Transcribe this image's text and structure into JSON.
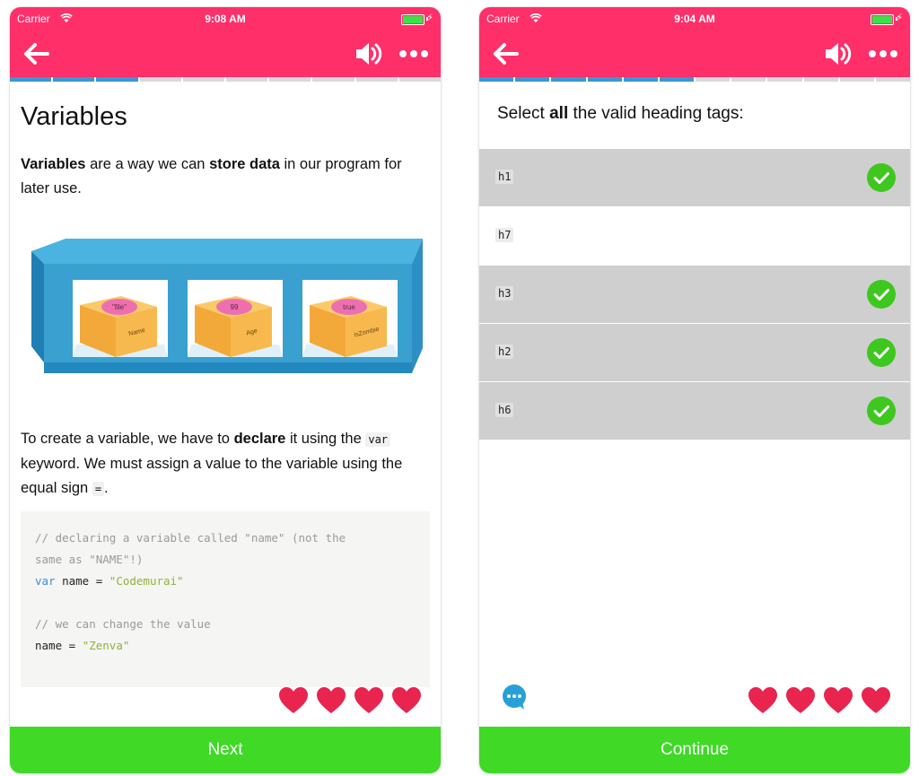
{
  "colors": {
    "header": "#ff2f6a",
    "progress_done": "#3b97d3",
    "button": "#3fd926",
    "heart": "#e8244f",
    "check": "#3ec71f"
  },
  "left": {
    "status": {
      "carrier": "Carrier",
      "time": "9:08 AM",
      "battery": 0.9
    },
    "progress": {
      "total": 10,
      "done": 3
    },
    "title": "Variables",
    "intro": {
      "bold1": "Variables",
      "t1": " are a way we can ",
      "bold2": "store data",
      "t2": " in our program for later use."
    },
    "illustration": {
      "boxes": [
        {
          "value": "\"file\"",
          "label": "Name"
        },
        {
          "value": "99",
          "label": "Age"
        },
        {
          "value": "true",
          "label": "isZombie"
        }
      ]
    },
    "para2": {
      "t1": "To create a variable, we have to ",
      "bold": "declare",
      "t2": " it using the ",
      "code1": "var",
      "t3": " keyword. We must assign a value to the variable using the equal sign ",
      "code2": "=",
      "t4": "."
    },
    "code": {
      "line1": "// declaring a variable called \"name\" (not the",
      "line2": "same as \"NAME\"!)",
      "line3_kw": "var",
      "line3_name": " name = ",
      "line3_str": "\"Codemurai\"",
      "line5": "// we can change the value",
      "line6_name": "name = ",
      "line6_str": "\"Zenva\""
    },
    "hearts": 4,
    "button": "Next"
  },
  "right": {
    "status": {
      "carrier": "Carrier",
      "time": "9:04 AM",
      "battery": 0.9
    },
    "progress": {
      "total": 12,
      "done": 6
    },
    "question": {
      "t1": "Select ",
      "bold": "all",
      "t2": " the valid heading tags:"
    },
    "options": [
      {
        "label": "h1",
        "selected": true
      },
      {
        "label": "h7",
        "selected": false
      },
      {
        "label": "h3",
        "selected": true
      },
      {
        "label": "h2",
        "selected": true
      },
      {
        "label": "h6",
        "selected": true
      }
    ],
    "hearts": 4,
    "button": "Continue"
  },
  "icons": {
    "back": "arrow-left-icon",
    "sound": "speaker-icon",
    "more": "more-dots-icon",
    "chat": "chat-bubble-icon",
    "heart": "heart-icon",
    "check": "check-circle-icon"
  }
}
